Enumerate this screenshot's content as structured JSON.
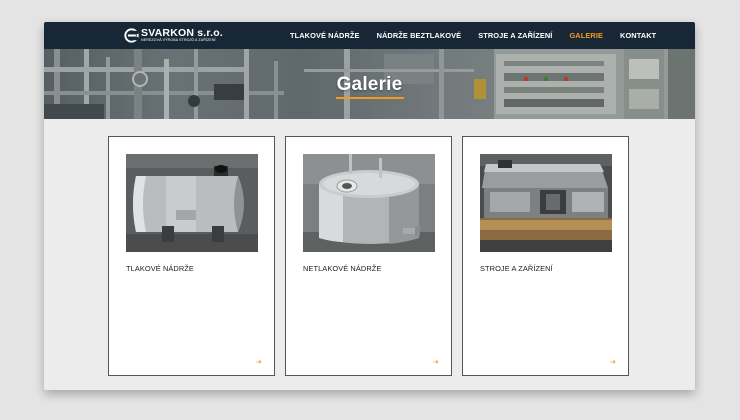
{
  "brand": {
    "name": "SVARKON s.r.o.",
    "tagline": "NEREZOVÁ VÝROBA STROJŮ A ZAŘÍZENÍ",
    "logo_icon": "svarkon-logo-mark",
    "accent": "#f39a1f",
    "nav_bg": "#182736"
  },
  "nav": {
    "items": [
      {
        "label": "TLAKOVÉ NÁDRŽE",
        "active": false
      },
      {
        "label": "NÁDRŽE BEZTLAKOVÉ",
        "active": false
      },
      {
        "label": "STROJE A ZAŘÍZENÍ",
        "active": false
      },
      {
        "label": "GALERIE",
        "active": true
      },
      {
        "label": "KONTAKT",
        "active": false
      }
    ]
  },
  "hero": {
    "title": "Galerie"
  },
  "gallery": {
    "cards": [
      {
        "label": "TLAKOVÉ NÁDRŽE",
        "image": "pressure-tank-photo",
        "arrow_icon": "arrow-right-icon"
      },
      {
        "label": "NETLAKOVÉ NÁDRŽE",
        "image": "non-pressure-tank-photo",
        "arrow_icon": "arrow-right-icon"
      },
      {
        "label": "STROJE A ZAŘÍZENÍ",
        "image": "machines-photo",
        "arrow_icon": "arrow-right-icon"
      }
    ]
  }
}
